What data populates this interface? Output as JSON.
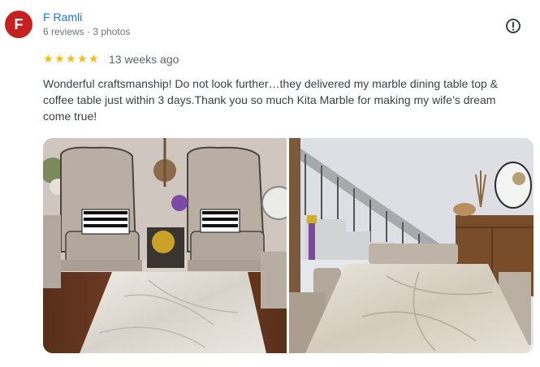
{
  "reviewer": {
    "avatar_letter": "F",
    "name": "F Ramli",
    "stats": "6 reviews · 3 photos"
  },
  "rating": {
    "stars": 5,
    "time": "13 weeks ago"
  },
  "review_text": "Wonderful craftsmanship! Do not look further…they delivered my marble dining table top & coffee table just within 3 days.Thank you so much Kita Marble for making my wife’s dream come true!",
  "photos": [
    {
      "subject": "living room with two wingback armchairs and a marble coffee table"
    },
    {
      "subject": "marble dining table top with chairs near a staircase"
    }
  ],
  "icons": {
    "menu": "report-icon",
    "star": "star-icon"
  },
  "colors": {
    "avatar_bg": "#c5221f",
    "name_link": "#1a73e8",
    "star": "#fbbc04"
  }
}
